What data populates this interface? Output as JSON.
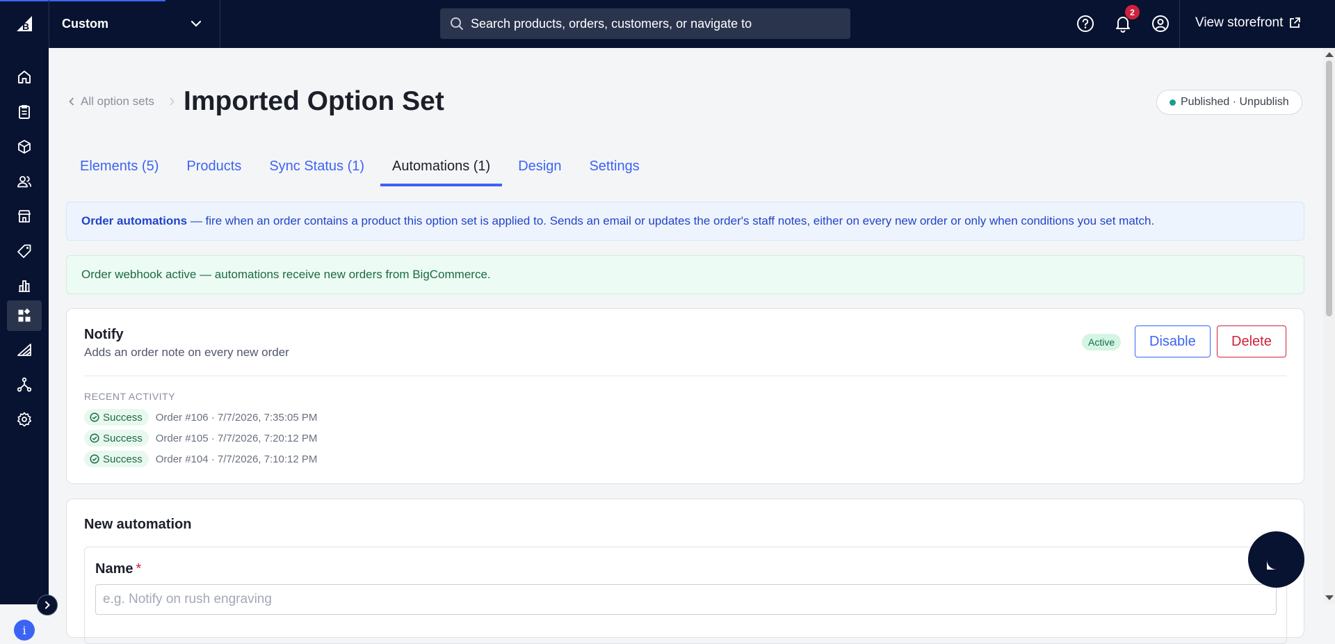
{
  "topbar": {
    "store_name": "Custom",
    "search_placeholder": "Search products, orders, customers, or navigate to",
    "notifications_count": "2",
    "view_storefront": "View storefront"
  },
  "sidebar": {
    "items": [
      {
        "icon": "home-icon"
      },
      {
        "icon": "orders-icon"
      },
      {
        "icon": "products-icon"
      },
      {
        "icon": "customers-icon"
      },
      {
        "icon": "storefront-icon"
      },
      {
        "icon": "marketing-icon"
      },
      {
        "icon": "analytics-icon"
      },
      {
        "icon": "apps-icon",
        "active": true
      },
      {
        "icon": "channel-manager-icon"
      },
      {
        "icon": "integrations-icon"
      },
      {
        "icon": "settings-icon"
      }
    ]
  },
  "header": {
    "breadcrumb": "All option sets",
    "title": "Imported Option Set",
    "status": "Published · Unpublish"
  },
  "tabs": [
    {
      "label": "Elements (5)"
    },
    {
      "label": "Products"
    },
    {
      "label": "Sync Status (1)"
    },
    {
      "label": "Automations (1)",
      "active": true
    },
    {
      "label": "Design"
    },
    {
      "label": "Settings"
    }
  ],
  "info_banner": {
    "bold": "Order automations",
    "text": " — fire when an order contains a product this option set is applied to. Sends an email or updates the order's staff notes, either on every new order or only when conditions you set match."
  },
  "webhook_banner": {
    "text": "Order webhook active — automations receive new orders from BigCommerce."
  },
  "automation": {
    "title": "Notify",
    "subtitle": "Adds an order note on every new order",
    "status": "Active",
    "disable_label": "Disable",
    "delete_label": "Delete",
    "activity_label": "RECENT ACTIVITY",
    "activity": [
      {
        "status": "Success",
        "detail": "Order #106 · 7/7/2026, 7:35:05 PM"
      },
      {
        "status": "Success",
        "detail": "Order #105 · 7/7/2026, 7:20:12 PM"
      },
      {
        "status": "Success",
        "detail": "Order #104 · 7/7/2026, 7:10:12 PM"
      }
    ]
  },
  "new_automation": {
    "title": "New automation",
    "name_label": "Name",
    "required_mark": "*",
    "name_placeholder": "e.g. Notify on rush engraving",
    "name_value": ""
  },
  "colors": {
    "nav_bg": "#071330",
    "accent": "#3c64f4",
    "danger": "#d0213b",
    "success": "#1b6a46"
  }
}
